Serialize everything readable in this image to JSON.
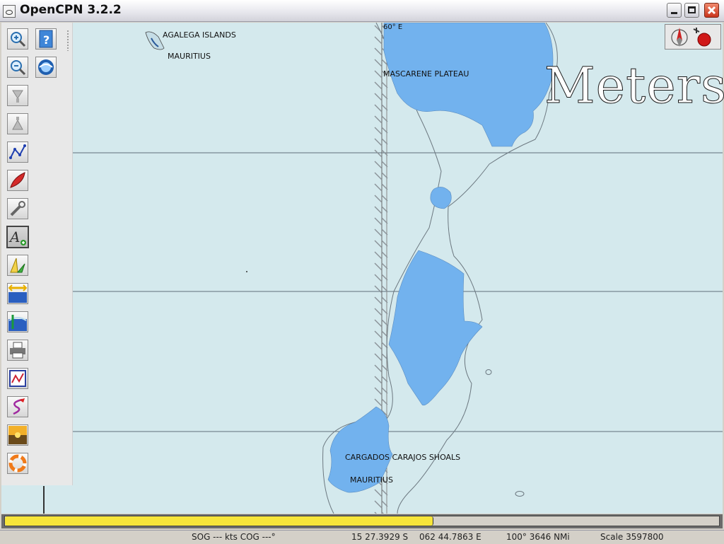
{
  "window": {
    "title": "OpenCPN 3.2.2",
    "buttons": {
      "minimize": "minimize-icon",
      "maximize": "maximize-icon",
      "close": "close-icon"
    }
  },
  "toolbar": {
    "tools": [
      {
        "icon": "zoom-in-icon"
      },
      {
        "icon": "help-icon"
      },
      {
        "icon": "zoom-out-icon"
      },
      {
        "icon": "google-earth-icon"
      },
      {
        "icon": "scale-in-icon"
      },
      {
        "icon": "scale-out-icon"
      },
      {
        "icon": "route-icon"
      },
      {
        "icon": "auto-follow-boat-icon"
      },
      {
        "icon": "settings-wrench-icon"
      },
      {
        "icon": "text-toggle-icon",
        "selected": true
      },
      {
        "icon": "current-tide-icon"
      },
      {
        "icon": "tide-icon"
      },
      {
        "icon": "current-icon"
      },
      {
        "icon": "print-icon"
      },
      {
        "icon": "route-manager-icon"
      },
      {
        "icon": "track-icon"
      },
      {
        "icon": "color-scheme-icon"
      },
      {
        "icon": "man-overboard-icon"
      }
    ]
  },
  "chart": {
    "labels": {
      "agalega": "AGALEGA ISLANDS",
      "mauritius_top": "MAURITIUS",
      "longitude": "60° E",
      "mascarene": "MASCARENE PLATEAU",
      "cargados": "CARGADOS CARAJOS SHOALS",
      "mauritius_bottom": "MAURITIUS"
    },
    "depth_unit_watermark": "Meters",
    "colors": {
      "sea": "#d4e9ed",
      "shoal": "#72b2ee",
      "grid": "#5f6f7a"
    }
  },
  "compass": {
    "icon": "compass-north-icon",
    "gps_icon": "gps-status-icon"
  },
  "progress": {
    "fraction": 0.6
  },
  "status": {
    "sog_cog": "SOG --- kts  COG ---°",
    "lat": "15 27.3929 S",
    "lon": "062 44.7863 E",
    "bearing_distance": "100°  3646 NMi",
    "scale": "Scale 3597800"
  }
}
